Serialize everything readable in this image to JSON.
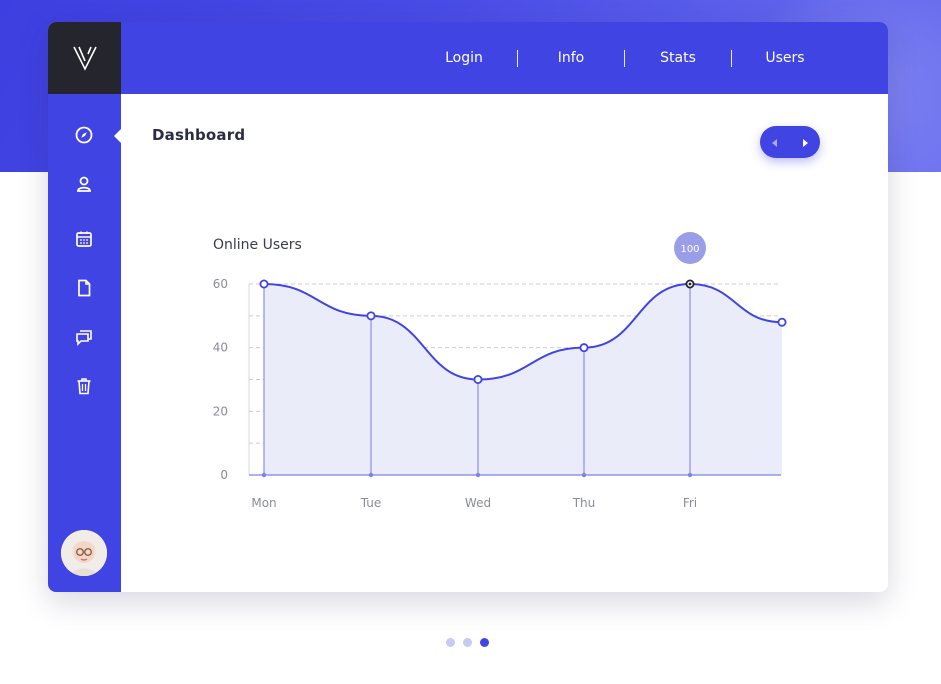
{
  "nav": {
    "items": [
      "Login",
      "Info",
      "Stats",
      "Users"
    ]
  },
  "logo": {
    "text": "V"
  },
  "page": {
    "title": "Dashboard"
  },
  "sidebar": {
    "icons": [
      "compass-icon",
      "user-icon",
      "calendar-icon",
      "document-icon",
      "chat-icon",
      "trash-icon"
    ]
  },
  "colors": {
    "primary": "#4044E3",
    "dark": "#25252D",
    "area_fill": "#EBECF9",
    "tooltip": "#9A9DE8"
  },
  "tooltip": {
    "value": "100"
  },
  "carousel": {
    "count": 3,
    "active_index": 2
  },
  "chart_data": {
    "type": "area",
    "title": "Online Users",
    "categories": [
      "Mon",
      "Tue",
      "Wed",
      "Thu",
      "Fri",
      ""
    ],
    "values": [
      60,
      50,
      30,
      40,
      60,
      48
    ],
    "ylim": [
      0,
      60
    ],
    "yticks": [
      0,
      20,
      40,
      60
    ],
    "grid": true,
    "highlight_index": 4
  }
}
